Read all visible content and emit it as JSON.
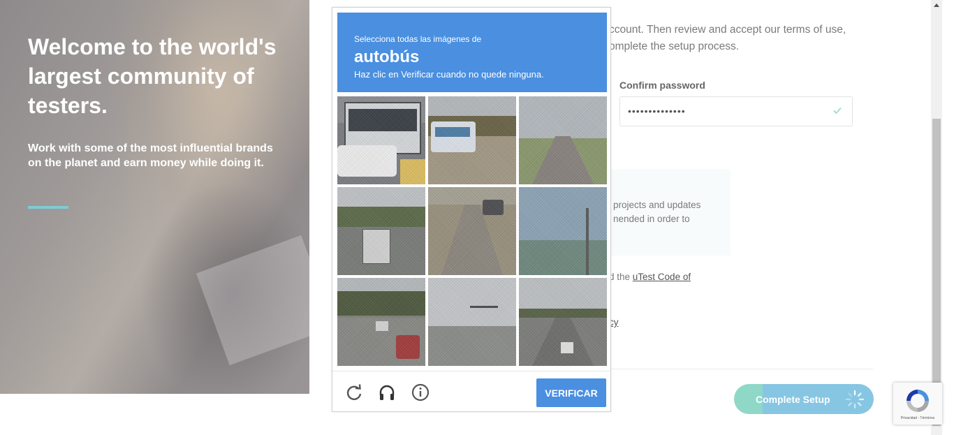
{
  "hero": {
    "title": "Welcome to the world's largest community of testers.",
    "subtitle": "Work with some of the most influential brands on the planet and earn money while doing it.",
    "accent_color": "#7ecad6"
  },
  "form": {
    "intro_line1": "ccount. Then review and accept our terms of use,",
    "intro_line2": "omplete the setup process.",
    "confirm_password_label": "Confirm password",
    "confirm_password_value": "••••••••••••••",
    "confirm_icon": "check-icon",
    "info_text_line1": "projects and updates",
    "info_text_line2": "nended in order to",
    "code_prefix": "d the ",
    "code_link": "uTest Code of",
    "policy_fragment": "cy",
    "complete_button_label": "Complete Setup",
    "complete_button_color": "#86c6e3"
  },
  "captcha": {
    "instruction": "Selecciona todas las imágenes de",
    "object": "autobús",
    "hint": "Haz clic en Verificar cuando no quede ninguna.",
    "verify_label": "VERIFICAR",
    "accent_color": "#4a8fe0",
    "footer_icons": [
      "reload-icon",
      "audio-headphones-icon",
      "info-icon"
    ]
  },
  "recaptcha_badge": {
    "text": "Privacidad - Términos"
  }
}
